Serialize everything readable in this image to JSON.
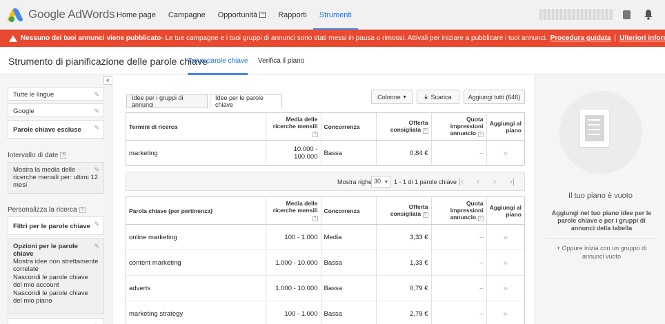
{
  "app": {
    "logo_text": "Google AdWords"
  },
  "nav": {
    "items": [
      {
        "label": "Home page"
      },
      {
        "label": "Campagne"
      },
      {
        "label": "Opportunità"
      },
      {
        "label": "Rapporti"
      },
      {
        "label": "Strumenti"
      }
    ]
  },
  "banner": {
    "bold": "Nessuno dei tuoi annunci viene pubblicato",
    "text": " - Le tue campagne e i tuoi gruppi di annunci sono stati messi in pausa o rimossi. Attivali per iniziare a pubblicare i tuoi annunci.",
    "link1": "Procedura guidata",
    "sep": "|",
    "link2": "Ulteriori informazioni",
    "color": "#e8492f"
  },
  "tool": {
    "title": "Strumento di pianificazione delle parole chiave",
    "tab_find": "Trova parole chiave",
    "tab_review": "Verifica il piano"
  },
  "sidebar": {
    "collapse": "«",
    "languages": "Tutte le lingue",
    "network": "Google",
    "negatives": "Parole chiave escluse",
    "date_label": "Intervallo di date",
    "date_value": "Mostra la media delle ricerche mensili per: ultimi 12 mesi",
    "customize_label": "Personalizza la ricerca",
    "filters": "Filtri per le parole chiave",
    "options_title": "Opzioni per le parole chiave",
    "option1": "Mostra idee non strettamente correlate",
    "option2": "Nascondi le parole chiave del mio account",
    "option3": "Nascondi le parole chiave del mio piano",
    "help": "?"
  },
  "main": {
    "tab_groups": "Idee per i gruppi di annunci",
    "tab_keywords": "Idee per le parole chiave",
    "btn_columns": "Colonne",
    "btn_download": "Scarica",
    "btn_add_all": "Aggiungi tutti (646)"
  },
  "search_table": {
    "headers": {
      "term": "Termini di ricerca",
      "avg": "Media delle ricerche mensili",
      "competition": "Concorrenza",
      "bid": "Offerta consigliata",
      "share": "Quota impressioni annuncio",
      "add": "Aggiungi al piano"
    },
    "rows": [
      {
        "term": "marketing",
        "avg": "10.000 - 100.000",
        "competition": "Bassa",
        "bid": "0,84 €",
        "share": "–",
        "add": "»"
      }
    ]
  },
  "pager": {
    "label": "Mostra righe:",
    "rows": "30",
    "range": "1 - 1 di 1 parole chiave"
  },
  "ideas_table": {
    "headers": {
      "term": "Parola chiave (per pertinenza)",
      "avg": "Media delle ricerche mensili",
      "competition": "Concorrenza",
      "bid": "Offerta consigliata",
      "share": "Quota impressioni annuncio",
      "add": "Aggiungi al piano"
    },
    "rows": [
      {
        "term": "online marketing",
        "avg": "100 - 1.000",
        "competition": "Media",
        "bid": "3,33 €",
        "share": "–",
        "add": "»"
      },
      {
        "term": "content marketing",
        "avg": "1.000 - 10.000",
        "competition": "Bassa",
        "bid": "1,33 €",
        "share": "–",
        "add": "»"
      },
      {
        "term": "adverts",
        "avg": "1.000 - 10.000",
        "competition": "Bassa",
        "bid": "0,79 €",
        "share": "–",
        "add": "»"
      },
      {
        "term": "marketing strategy",
        "avg": "100 - 1.000",
        "competition": "Bassa",
        "bid": "2,79 €",
        "share": "–",
        "add": "»"
      }
    ]
  },
  "plan": {
    "title": "Il tuo piano è vuoto",
    "desc": "Aggiungi nel tuo piano idee per le parole chiave e per i gruppi di annunci della tabella",
    "alt": "+ Oppure inizia con un gruppo di annunci vuoto"
  }
}
